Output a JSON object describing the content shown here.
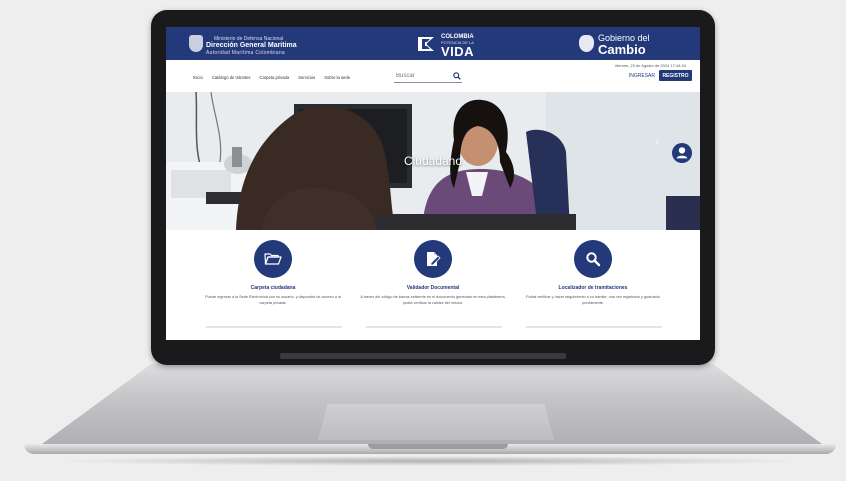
{
  "banner": {
    "dimar_line1": "Ministerio de Defensa Nacional",
    "dimar_line2": "Dirección General Marítima",
    "dimar_line3": "Autoridad Marítima Colombiana",
    "vida_line1": "COLOMBIA",
    "vida_line2": "POTENCIA DE LA",
    "vida_line3": "VIDA",
    "gob_line1": "Gobierno del",
    "gob_line2": "Cambio"
  },
  "header": {
    "date": "Viernes, 23 de Agosto de 2024 17:44:34",
    "nav": [
      "Inicio",
      "Catálogo de trámites",
      "Carpeta privada",
      "Servicios",
      "Sobre la sede"
    ],
    "search_placeholder": "Buscar",
    "login_label": "INGRESAR",
    "register_label": "REGISTRO"
  },
  "hero": {
    "title": "Ciudadano",
    "next_label": "›"
  },
  "cards": [
    {
      "icon": "folder-open-icon",
      "title": "Carpeta ciudadana",
      "description": "Puede ingresar a la Sede Electrónica con su usuario, y dispondrá de acceso a la carpeta privada."
    },
    {
      "icon": "document-edit-icon",
      "title": "Validador Documental",
      "description": "A través del código de barras existente en el documento generado en esta plataforma, podrá verificar la validez del mismo."
    },
    {
      "icon": "search-icon",
      "title": "Localizador de tramitaciones",
      "description": "Podrá verificar y hacer seguimiento a su trámite, una vez registrado y guardado previamente."
    }
  ],
  "colors": {
    "brand": "#23397a",
    "background": "#eeeeee"
  }
}
